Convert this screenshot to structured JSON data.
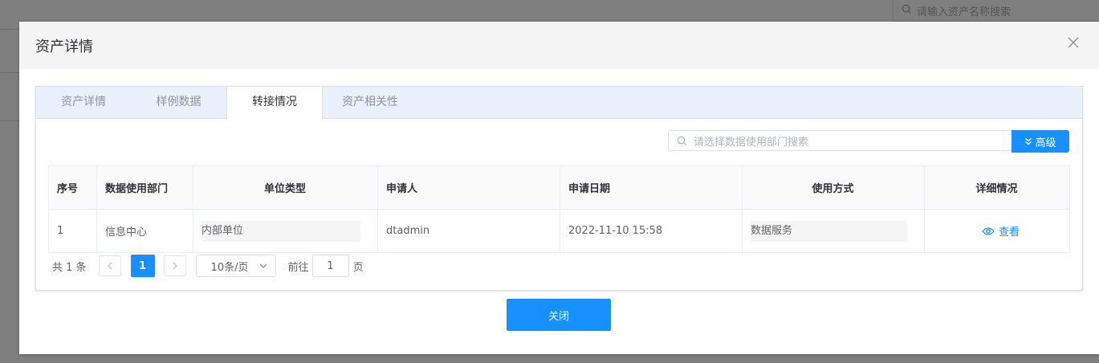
{
  "background": {
    "search_placeholder": "请输入资产名称搜索"
  },
  "dialog": {
    "title": "资产详情",
    "tabs": [
      {
        "label": "资产详情",
        "active": false
      },
      {
        "label": "样例数据",
        "active": false
      },
      {
        "label": "转接情况",
        "active": true
      },
      {
        "label": "资产相关性",
        "active": false
      }
    ],
    "search": {
      "placeholder": "请选择数据使用部门搜索",
      "advanced_label": "高级"
    },
    "table": {
      "headers": [
        "序号",
        "数据使用部门",
        "单位类型",
        "申请人",
        "申请日期",
        "使用方式",
        "详细情况"
      ],
      "rows": [
        {
          "index": "1",
          "department": "信息中心",
          "unit_type": "内部单位",
          "applicant": "dtadmin",
          "date": "2022-11-10 15:58",
          "usage": "数据服务",
          "detail_link": "查看"
        }
      ]
    },
    "pagination": {
      "total_text": "共 1 条",
      "current_page": "1",
      "page_size": "10条/页",
      "goto_prefix": "前往",
      "goto_value": "1",
      "goto_suffix": "页"
    },
    "close_label": "关闭"
  },
  "colors": {
    "accent": "#1890ff",
    "tab_bar": "#eaf1fc",
    "overlay": "#7f7f7f"
  }
}
